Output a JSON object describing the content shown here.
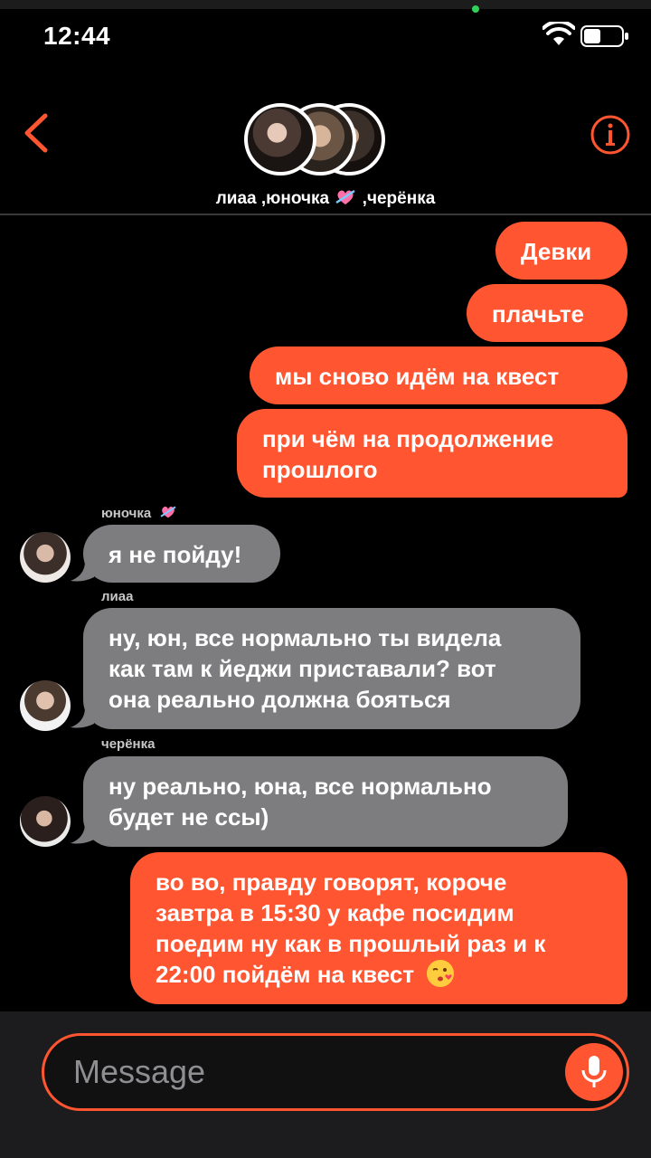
{
  "status_bar": {
    "time": "12:44",
    "icons": [
      "wifi-icon",
      "battery-icon"
    ]
  },
  "header": {
    "back_icon": "chevron-left-icon",
    "info_icon": "info-icon",
    "title_part1": "лиаа ,юночка",
    "title_part2": ",черёнка",
    "title_emoji": "heart-arrow-emoji",
    "accent_color": "#ff5631"
  },
  "messages": [
    {
      "type": "outgoing",
      "text": "Девки"
    },
    {
      "type": "outgoing",
      "text": "плачьте"
    },
    {
      "type": "outgoing",
      "text": "мы сново идём на квест"
    },
    {
      "type": "outgoing",
      "line1": "при чём на продолжение",
      "line2": "прошлого"
    },
    {
      "type": "incoming",
      "sender": "юночка",
      "sender_emoji": "heart-arrow-emoji",
      "text": "я не пойду!"
    },
    {
      "type": "incoming",
      "sender": "лиаа",
      "line1": "ну, юн, все нормально ты видела",
      "line2": "как там к йеджи приставали? вот",
      "line3": "она реально должна бояться"
    },
    {
      "type": "incoming",
      "sender": "черёнка",
      "line1": "ну реально, юна, все нормально",
      "line2": "будет не ссы)"
    },
    {
      "type": "outgoing",
      "line1": "во во, правду говорят, короче",
      "line2": "завтра в 15:30 у кафе посидим",
      "line3": "поедим ну как в прошлый раз и к",
      "line4": "22:00 пойдём на квест",
      "emoji": "kiss-wink-emoji"
    }
  ],
  "composer": {
    "placeholder": "Message",
    "mic_icon": "microphone-icon"
  }
}
